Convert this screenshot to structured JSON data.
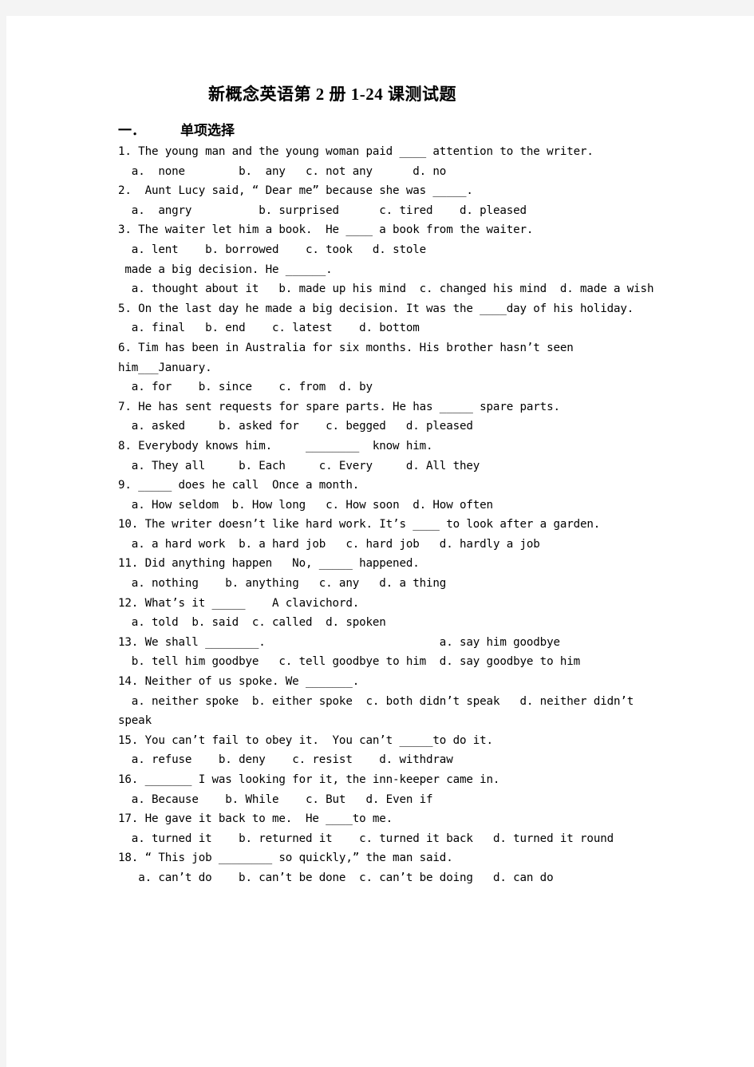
{
  "page": {
    "background": "#f4f4f4",
    "paper_color": "#ffffff"
  },
  "document": {
    "title": "新概念英语第 2 册 1-24 课测试题",
    "section_heading_number": "一．",
    "section_heading_label": "单项选择"
  },
  "lines": [
    {
      "id": "q1-stem",
      "text": "1. The young man and the young woman paid ____ attention to the writer."
    },
    {
      "id": "q1-options",
      "text": "  a.  none        b.  any   c. not any      d. no"
    },
    {
      "id": "q2-stem",
      "text": "2.  Aunt Lucy said, “ Dear me” because she was _____."
    },
    {
      "id": "q2-options",
      "text": "  a.  angry          b. surprised      c. tired    d. pleased"
    },
    {
      "id": "q3-stem",
      "text": "3. The waiter let him a book.  He ____ a book from the waiter."
    },
    {
      "id": "q3-options",
      "text": "  a. lent    b. borrowed    c. took   d. stole"
    },
    {
      "id": "q4-stem",
      "text": " made a big decision. He ______."
    },
    {
      "id": "q4-options",
      "text": "  a. thought about it   b. made up his mind  c. changed his mind  d. made a wish"
    },
    {
      "id": "q5-stem",
      "text": "5. On the last day he made a big decision. It was the ____day of his holiday."
    },
    {
      "id": "q5-options",
      "text": "  a. final   b. end    c. latest    d. bottom"
    },
    {
      "id": "q6-stem",
      "text": "6. Tim has been in Australia for six months. His brother hasn’t seen him___January."
    },
    {
      "id": "q6-options",
      "text": "  a. for    b. since    c. from  d. by"
    },
    {
      "id": "q7-stem",
      "text": "7. He has sent requests for spare parts. He has _____ spare parts."
    },
    {
      "id": "q7-options",
      "text": "  a. asked     b. asked for    c. begged   d. pleased"
    },
    {
      "id": "q8-stem",
      "text": "8. Everybody knows him.     ________  know him."
    },
    {
      "id": "q8-options",
      "text": "  a. They all     b. Each     c. Every     d. All they"
    },
    {
      "id": "q9-stem",
      "text": "9. _____ does he call  Once a month."
    },
    {
      "id": "q9-options",
      "text": "  a. How seldom  b. How long   c. How soon  d. How often"
    },
    {
      "id": "q10-stem",
      "text": "10. The writer doesn’t like hard work. It’s ____ to look after a garden."
    },
    {
      "id": "q10-options",
      "text": "  a. a hard work  b. a hard job   c. hard job   d. hardly a job"
    },
    {
      "id": "q11-stem",
      "text": "11. Did anything happen   No, _____ happened."
    },
    {
      "id": "q11-options",
      "text": "  a. nothing    b. anything   c. any   d. a thing"
    },
    {
      "id": "q12-stem",
      "text": "12. What’s it _____    A clavichord."
    },
    {
      "id": "q12-options",
      "text": "  a. told  b. said  c. called  d. spoken"
    },
    {
      "id": "q13-stem",
      "text": "13. We shall ________.                          a. say him goodbye"
    },
    {
      "id": "q13-options",
      "text": "  b. tell him goodbye   c. tell goodbye to him  d. say goodbye to him"
    },
    {
      "id": "q14-stem",
      "text": "14. Neither of us spoke. We _______."
    },
    {
      "id": "q14-options",
      "text": "  a. neither spoke  b. either spoke  c. both didn’t speak   d. neither didn’t speak"
    },
    {
      "id": "q15-stem",
      "text": "15. You can’t fail to obey it.  You can’t _____to do it."
    },
    {
      "id": "q15-options",
      "text": "  a. refuse    b. deny    c. resist    d. withdraw"
    },
    {
      "id": "q16-stem",
      "text": "16. _______ I was looking for it, the inn-keeper came in."
    },
    {
      "id": "q16-options",
      "text": "  a. Because    b. While    c. But   d. Even if"
    },
    {
      "id": "q17-stem",
      "text": "17. He gave it back to me.  He ____to me."
    },
    {
      "id": "q17-options",
      "text": "  a. turned it    b. returned it    c. turned it back   d. turned it round"
    },
    {
      "id": "q18-stem",
      "text": "18. “ This job ________ so quickly,” the man said."
    },
    {
      "id": "q18-options",
      "text": "   a. can’t do    b. can’t be done  c. can’t be doing   d. can do"
    }
  ]
}
